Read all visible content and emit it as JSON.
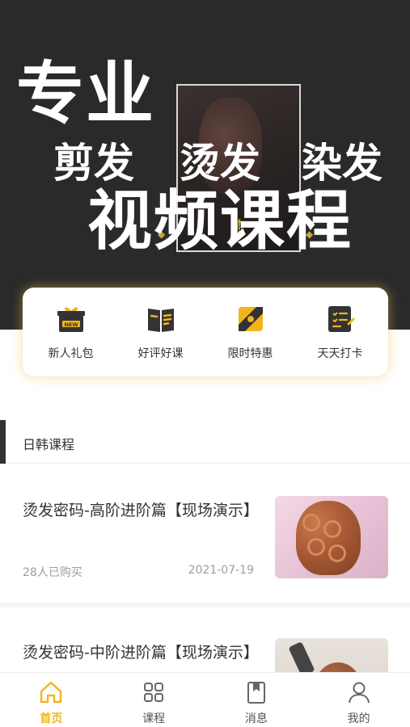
{
  "banner": {
    "line1": "专业",
    "cut": "剪发",
    "perm": "烫发",
    "dye": "染发",
    "line3": "视频课程"
  },
  "quick_actions": [
    {
      "label": "新人礼包",
      "icon": "gift-new-icon",
      "badge": "NEW"
    },
    {
      "label": "好评好课",
      "icon": "book-rating-icon"
    },
    {
      "label": "限时特惠",
      "icon": "coupon-icon"
    },
    {
      "label": "天天打卡",
      "icon": "checkin-clipboard-icon"
    }
  ],
  "section": {
    "title": "日韩课程"
  },
  "courses": [
    {
      "title": "烫发密码-高阶进阶篇【现场演示】",
      "sales": "28人已购买",
      "date": "2021-07-19"
    },
    {
      "title": "烫发密码-中阶进阶篇【现场演示】"
    }
  ],
  "bottom_nav": [
    {
      "label": "首页",
      "icon": "home-icon",
      "active": true
    },
    {
      "label": "课程",
      "icon": "grid-icon",
      "active": false
    },
    {
      "label": "消息",
      "icon": "bookmark-book-icon",
      "active": false
    },
    {
      "label": "我的",
      "icon": "user-icon",
      "active": false
    }
  ],
  "colors": {
    "accent": "#f2b41c",
    "banner_bg": "#2a2a2a",
    "icon_dark": "#333333"
  }
}
